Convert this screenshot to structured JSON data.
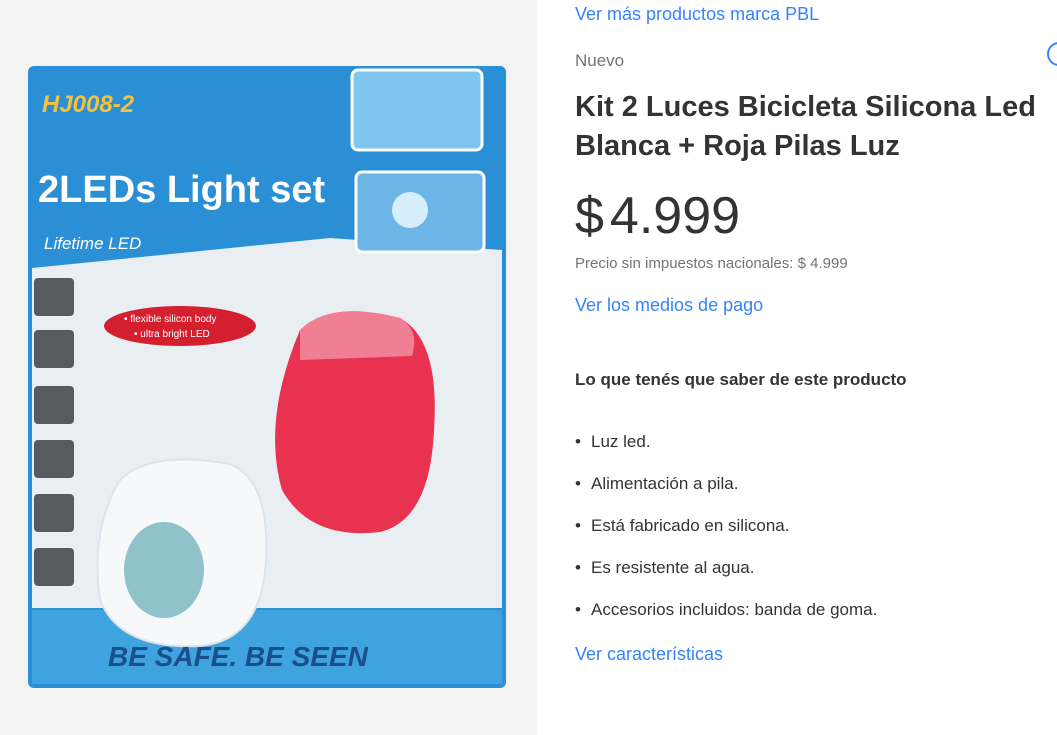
{
  "brand_link": "Ver más productos marca PBL",
  "condition": "Nuevo",
  "title": "Kit 2 Luces Bicicleta Silicona Led Blanca + Roja Pilas Luz",
  "price": {
    "currency": "$",
    "amount": "4.999"
  },
  "tax_note": "Precio sin impuestos nacionales: $ 4.999",
  "payment_link": "Ver los medios de pago",
  "section_title": "Lo que tenés que saber de este producto",
  "features": [
    "Luz led.",
    "Alimentación a pila.",
    "Está fabricado en silicona.",
    "Es resistente al agua.",
    "Accesorios incluidos: banda de goma."
  ],
  "specs_link": "Ver características",
  "product_image": {
    "model": "HJ008-2",
    "headline": "2LEDs Light set",
    "sub": "Lifetime LED",
    "badge_line1": "• flexible silicon body",
    "badge_line2": "• ultra bright LED",
    "slogan": "BE SAFE.  BE SEEN"
  },
  "colors": {
    "link": "#3483fa",
    "text": "#333333",
    "muted": "#737373",
    "package_blue": "#1f7fc4",
    "red_light": "#e8324f"
  },
  "icons": [
    "favorite-heart-icon"
  ]
}
